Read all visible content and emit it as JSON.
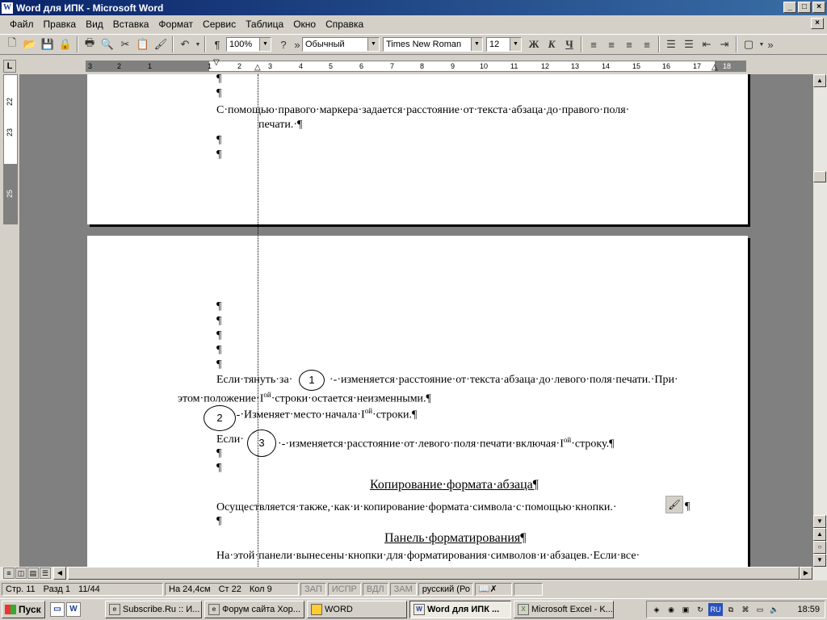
{
  "window": {
    "title": "Word для  ИПК - Microsoft Word",
    "min": "_",
    "max": "□",
    "close": "×"
  },
  "menu": [
    "Файл",
    "Правка",
    "Вид",
    "Вставка",
    "Формат",
    "Сервис",
    "Таблица",
    "Окно",
    "Справка"
  ],
  "toolbar": {
    "zoom": "100%",
    "style": "Обычный",
    "font": "Times New Roman",
    "size": "12",
    "bold": "Ж",
    "italic": "К",
    "underline": "Ч",
    "pilcrow": "¶"
  },
  "ruler": {
    "corner": "L",
    "left_numbers": [
      "3",
      "2",
      "1"
    ],
    "numbers": [
      "1",
      "2",
      "3",
      "4",
      "5",
      "6",
      "7",
      "8",
      "9",
      "10",
      "11",
      "12",
      "13",
      "14",
      "15",
      "16",
      "17",
      "18"
    ],
    "vnumbers": [
      "22",
      "23",
      "25"
    ]
  },
  "document": {
    "page1_pmarks": [
      "¶",
      "¶"
    ],
    "page1_line1": "С·помощью·правого·маркера·задается·расстояние·от·текста·абзаца·до·правого·поля·",
    "page1_line2": "печати.·¶",
    "page1_after": [
      "¶",
      "¶"
    ],
    "page2_pmarks": [
      "¶",
      "¶",
      "¶",
      "¶",
      "¶"
    ],
    "para1_a": "Если·тянуть·за·",
    "para1_b": "·-·изменяется·расстояние·от·текста·абзаца·до·левого·поля·печати.·При·",
    "para1_c_pre": "этом·положение·I",
    "para1_c_sup": "ой",
    "para1_c_post": "·строки·остается·неизменными.¶",
    "para2_pre": "·-·Изменяет·место·начала·I",
    "para2_sup": "ой",
    "para2_post": "·строки.¶",
    "para3_a": "Если·",
    "para3_b_pre": "·-·изменяется·расстояние·от·левого·поля·печати·включая·I",
    "para3_b_sup": "ой",
    "para3_b_post": "·строку.¶",
    "mid_pmarks": [
      "¶",
      "¶"
    ],
    "heading1": "Копирование·формата·абзаца¶",
    "para4": "Осуществляется·также,·как·и·копирование·формата·символа·с·помощью·кнопки.·",
    "para4_end": "¶",
    "after4": "¶",
    "heading2": "Панель·форматирования¶",
    "para5": "На·этой·панели·вынесены·кнопки·для·форматирования·символов·и·абзацев.·Если·все·",
    "circle1": "1",
    "circle2": "2",
    "circle3": "3"
  },
  "status": {
    "page": "Стр. 11",
    "section": "Разд 1",
    "pages": "11/44",
    "at": "На 24,4см",
    "line": "Ст 22",
    "col": "Кол 9",
    "rec": "ЗАП",
    "trk": "ИСПР",
    "ext": "ВДЛ",
    "ovr": "ЗАМ",
    "lang": "русский (Ро"
  },
  "taskbar": {
    "start": "Пуск",
    "tasks": [
      {
        "label": "Subscribe.Ru :: И...",
        "active": false
      },
      {
        "label": "Форум сайта Хор...",
        "active": false
      },
      {
        "label": "WORD",
        "active": false
      },
      {
        "label": "Word для  ИПК ...",
        "active": true
      },
      {
        "label": "Microsoft Excel - K...",
        "active": false
      }
    ],
    "lang": "RU",
    "clock": "18:59"
  }
}
